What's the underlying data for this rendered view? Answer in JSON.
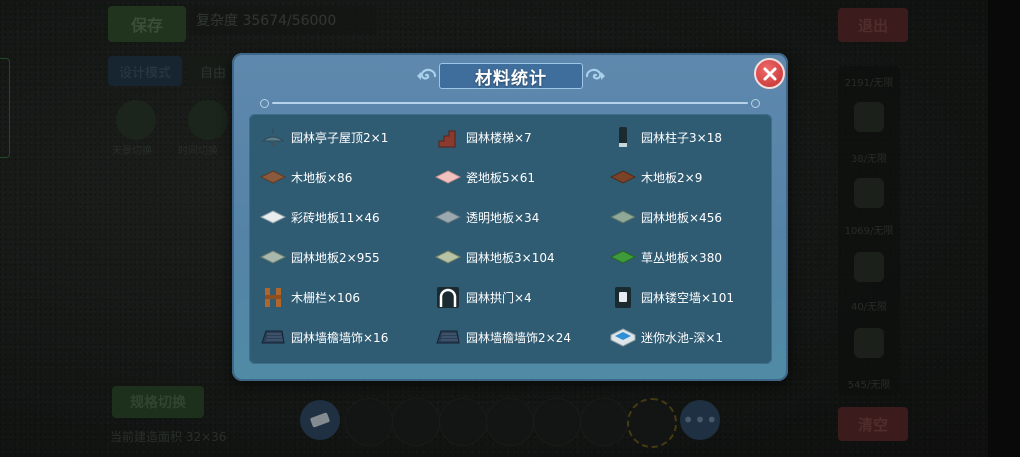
{
  "background": {
    "save_label": "保存",
    "complexity": "复杂度 35674/56000",
    "exit_label": "退出",
    "design_mode_label": "设计模式",
    "free_mode_label": "自由",
    "scene_1_label": "天景切换",
    "scene_2_label": "时间切换",
    "grid_mode_label": "规格切换",
    "area_label": "当前建造面积 32×36",
    "clear_label": "清空",
    "side_counts": [
      "2191/无限",
      "38/无限",
      "1069/无限",
      "40/无限",
      "545/无限"
    ]
  },
  "dialog": {
    "title": "材料统计",
    "items": [
      {
        "label": "园林亭子屋顶2×1",
        "icon": "pavilion-roof-icon"
      },
      {
        "label": "园林楼梯×7",
        "icon": "garden-stairs-icon"
      },
      {
        "label": "园林柱子3×18",
        "icon": "garden-pillar-icon"
      },
      {
        "label": "木地板×86",
        "icon": "wood-floor-icon"
      },
      {
        "label": "瓷地板5×61",
        "icon": "porcelain-floor-icon"
      },
      {
        "label": "木地板2×9",
        "icon": "wood-floor-2-icon"
      },
      {
        "label": "彩砖地板11×46",
        "icon": "color-tile-floor-icon"
      },
      {
        "label": "透明地板×34",
        "icon": "glass-floor-icon"
      },
      {
        "label": "园林地板×456",
        "icon": "garden-floor-icon"
      },
      {
        "label": "园林地板2×955",
        "icon": "garden-floor-2-icon"
      },
      {
        "label": "园林地板3×104",
        "icon": "garden-floor-3-icon"
      },
      {
        "label": "草丛地板×380",
        "icon": "grass-floor-icon"
      },
      {
        "label": "木栅栏×106",
        "icon": "wood-fence-icon"
      },
      {
        "label": "园林拱门×4",
        "icon": "garden-arch-icon"
      },
      {
        "label": "园林镂空墙×101",
        "icon": "garden-lattice-wall-icon"
      },
      {
        "label": "园林墙檐墙饰×16",
        "icon": "wall-eave-icon"
      },
      {
        "label": "园林墙檐墙饰2×24",
        "icon": "wall-eave-2-icon"
      },
      {
        "label": "迷你水池-深×1",
        "icon": "mini-pool-icon"
      }
    ]
  }
}
